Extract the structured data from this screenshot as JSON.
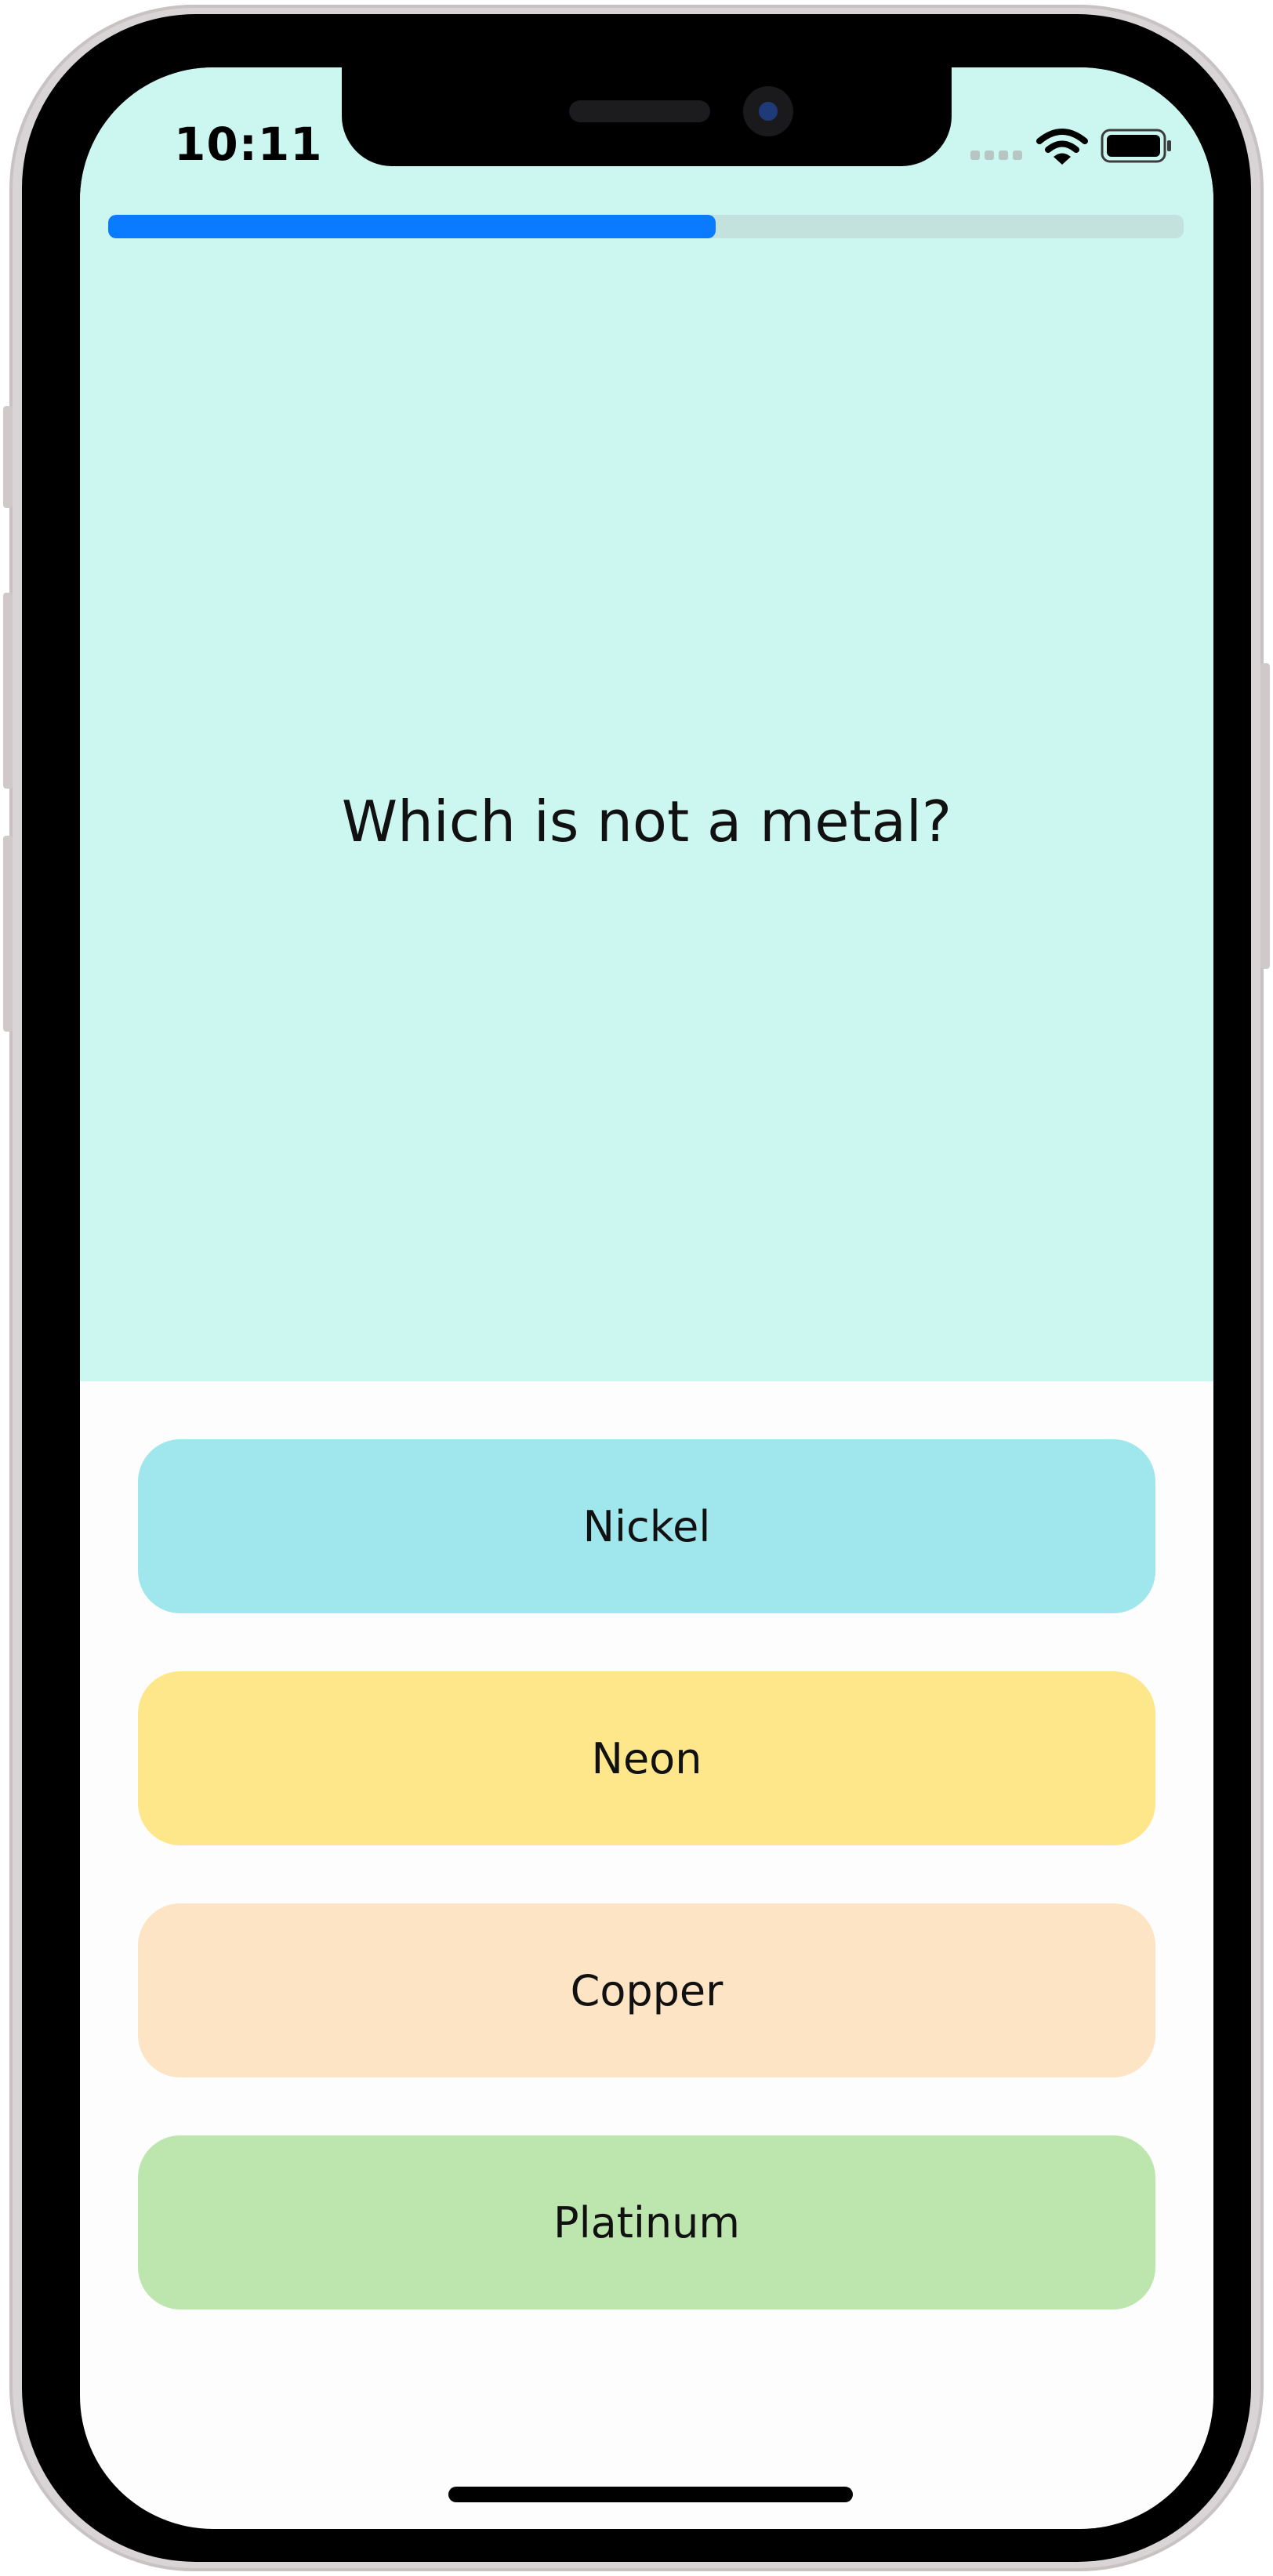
{
  "status_bar": {
    "time": "10:11",
    "wifi_icon": "wifi-icon",
    "battery_icon": "battery-icon",
    "signal_icon": "cellular-signal-icon"
  },
  "progress": {
    "fraction": 0.565,
    "fill_color": "#0a7bff",
    "track_color": "#c3e2dd"
  },
  "question": {
    "text": "Which is not a metal?",
    "background_color": "#ccf7f0"
  },
  "answers": [
    {
      "label": "Nickel",
      "color": "#a0e6ed"
    },
    {
      "label": "Neon",
      "color": "#fde78a"
    },
    {
      "label": "Copper",
      "color": "#fce4c4"
    },
    {
      "label": "Platinum",
      "color": "#bce6ae"
    }
  ]
}
